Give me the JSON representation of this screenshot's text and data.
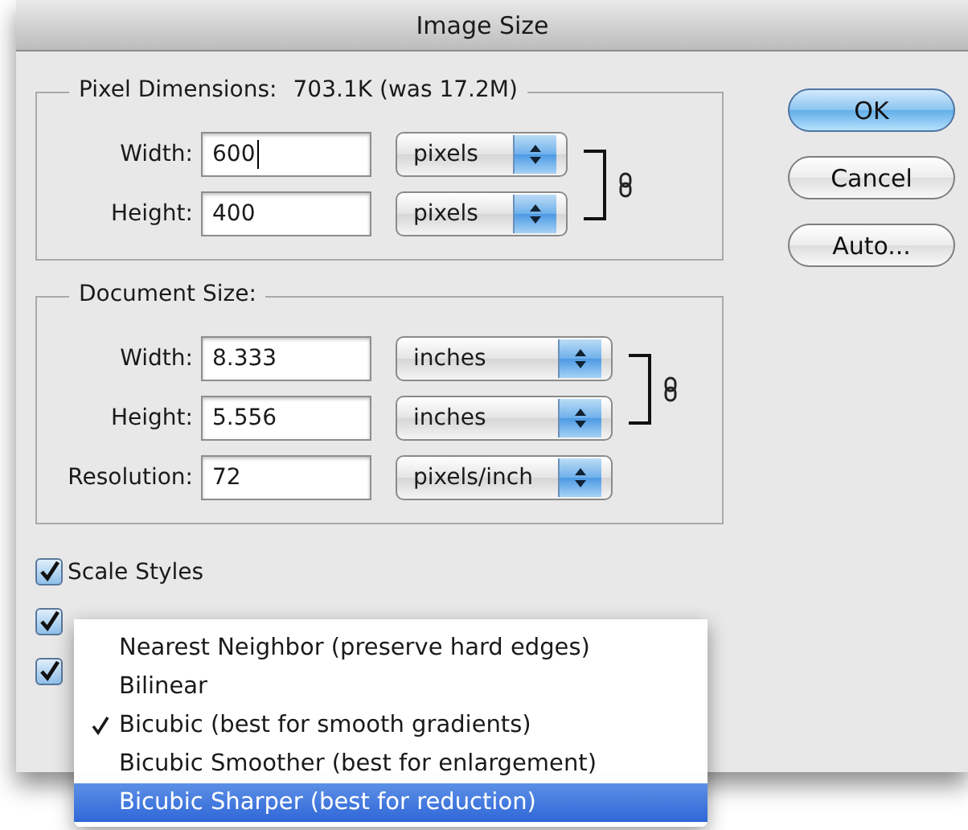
{
  "window": {
    "title": "Image Size"
  },
  "pixel_dimensions": {
    "label": "Pixel Dimensions:",
    "value": "703.1K (was 17.2M)",
    "linked": true,
    "rows": [
      {
        "label": "Width:",
        "value": "600",
        "unit": "pixels",
        "focused": true
      },
      {
        "label": "Height:",
        "value": "400",
        "unit": "pixels",
        "focused": false
      }
    ]
  },
  "document_size": {
    "label": "Document Size:",
    "linked": true,
    "rows": [
      {
        "label": "Width:",
        "value": "8.333",
        "unit": "inches",
        "focused": false
      },
      {
        "label": "Height:",
        "value": "5.556",
        "unit": "inches",
        "focused": false
      },
      {
        "label": "Resolution:",
        "value": "72",
        "unit": "pixels/inch",
        "focused": false
      }
    ]
  },
  "buttons": [
    {
      "label": "OK",
      "default": true
    },
    {
      "label": "Cancel",
      "default": false
    },
    {
      "label": "Auto...",
      "default": false
    }
  ],
  "checkboxes": [
    {
      "label": "Scale Styles",
      "checked": true
    },
    {
      "checked": true
    },
    {
      "checked": true
    }
  ],
  "resample_menu": {
    "items": [
      {
        "label": "Nearest Neighbor (preserve hard edges)",
        "checked": false,
        "selected": false
      },
      {
        "label": "Bilinear",
        "checked": false,
        "selected": false
      },
      {
        "label": "Bicubic (best for smooth gradients)",
        "checked": true,
        "selected": false
      },
      {
        "label": "Bicubic Smoother (best for enlargement)",
        "checked": false,
        "selected": false
      },
      {
        "label": "Bicubic Sharper (best for reduction)",
        "checked": false,
        "selected": true
      }
    ]
  }
}
